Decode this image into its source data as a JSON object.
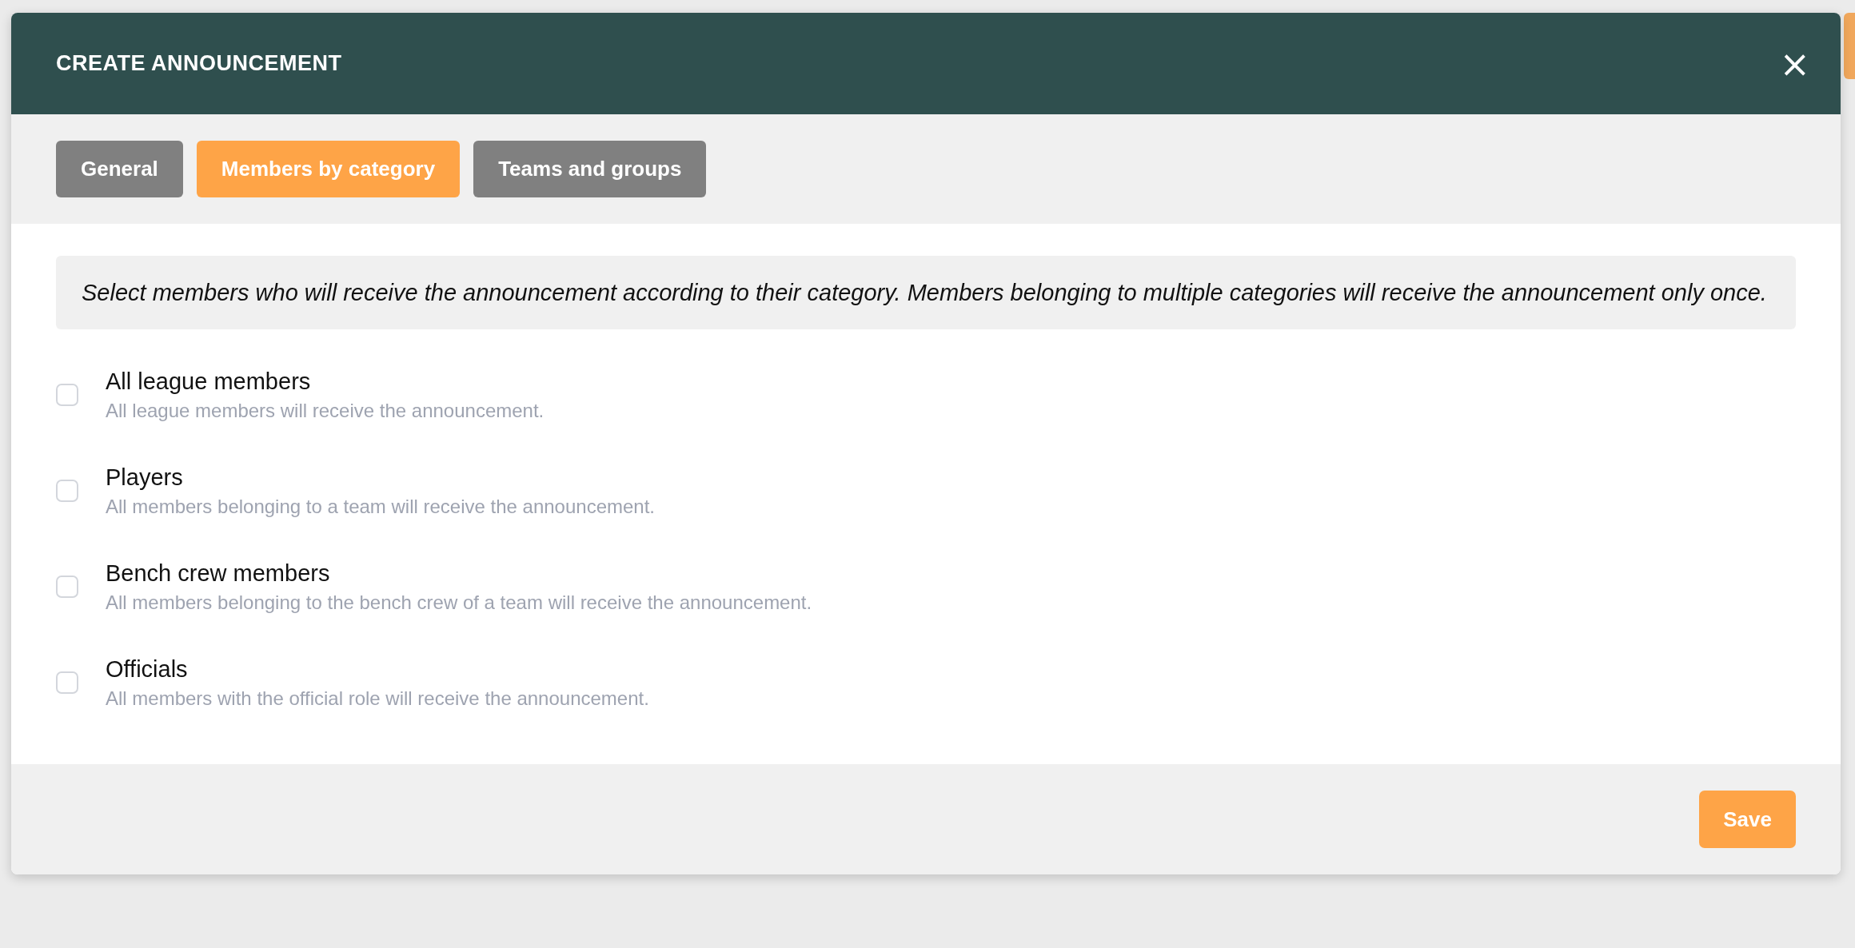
{
  "dialog": {
    "title": "CREATE ANNOUNCEMENT",
    "close": "×"
  },
  "tabs": [
    {
      "label": "General",
      "selected": false
    },
    {
      "label": "Members by category",
      "selected": true
    },
    {
      "label": "Teams and groups",
      "selected": false
    }
  ],
  "info": "Select members who will receive the announcement according to their category. Members belonging to multiple categories will receive the announcement only once.",
  "categories": [
    {
      "label": "All league members",
      "description": "All league members will receive the announcement.",
      "checked": false
    },
    {
      "label": "Players",
      "description": "All members belonging to a team will receive the announcement.",
      "checked": false
    },
    {
      "label": "Bench crew members",
      "description": "All members belonging to the bench crew of a team will receive the announcement.",
      "checked": false
    },
    {
      "label": "Officials",
      "description": "All members with the official role will receive the announcement.",
      "checked": false
    }
  ],
  "footer": {
    "save": "Save"
  }
}
